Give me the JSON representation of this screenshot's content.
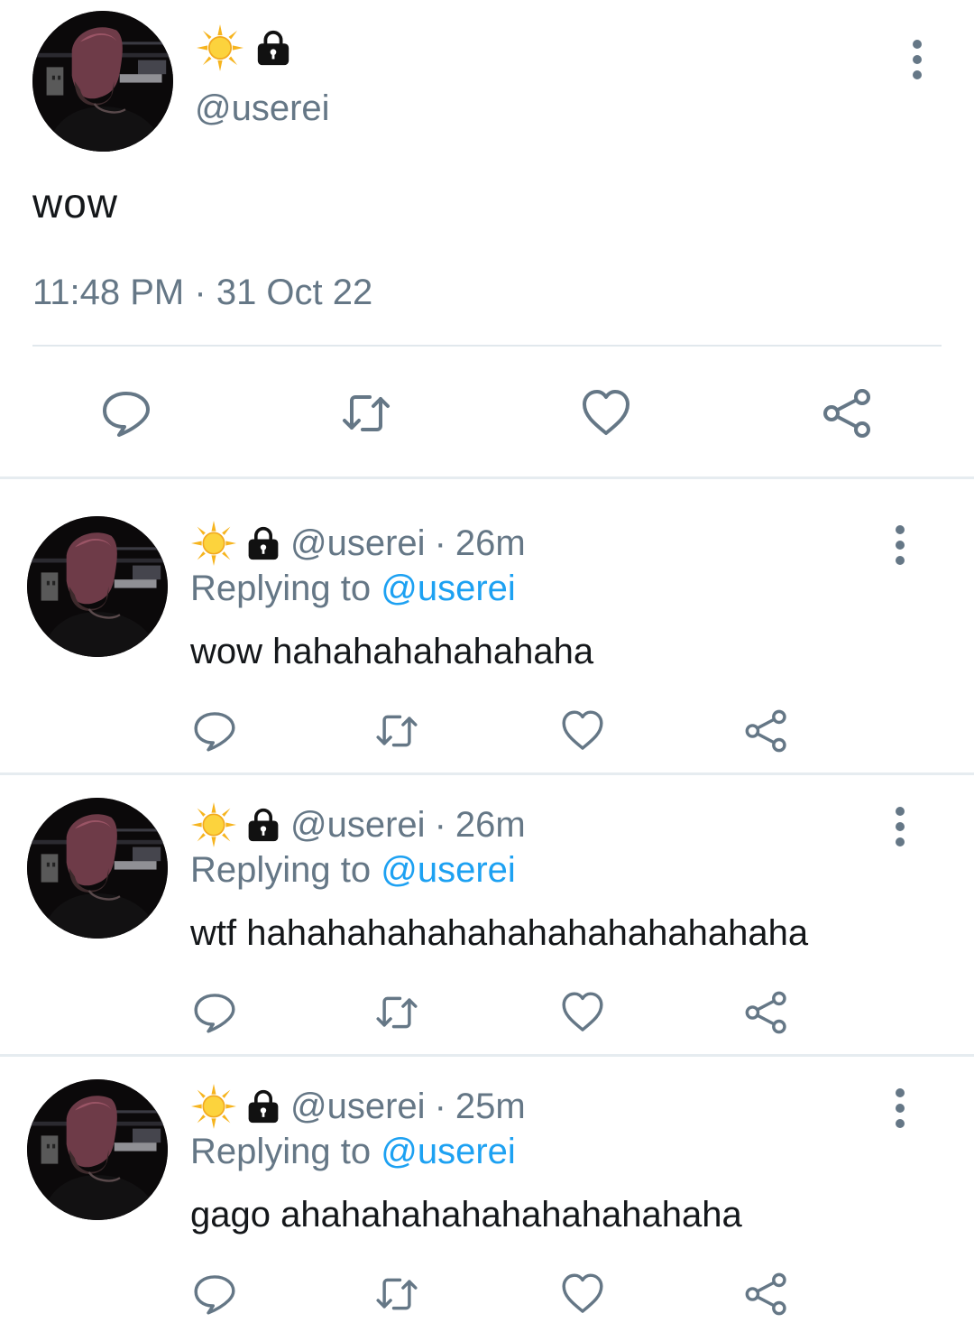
{
  "main_tweet": {
    "handle": "@userei",
    "text": "wow",
    "time": "11:48 PM",
    "separator": "·",
    "date": "31 Oct 22"
  },
  "replies": [
    {
      "handle": "@userei",
      "separator": "·",
      "age": "26m",
      "replying_label": "Replying to",
      "replying_mention": "@userei",
      "text": "wow hahahahahahahaha"
    },
    {
      "handle": "@userei",
      "separator": "·",
      "age": "26m",
      "replying_label": "Replying to",
      "replying_mention": "@userei",
      "text": "wtf hahahahahahahahahahahahahaha"
    },
    {
      "handle": "@userei",
      "separator": "·",
      "age": "25m",
      "replying_label": "Replying to",
      "replying_mention": "@userei",
      "text": "gago ahahahahahahahahahahaha"
    }
  ],
  "icons": {
    "name_emoji": "sun-icon",
    "protected": "lock-icon",
    "reply": "reply-bubble-icon",
    "retweet": "retweet-icon",
    "like": "heart-icon",
    "share": "share-icon",
    "more": "more-vertical-icon"
  },
  "colors": {
    "text": "#14171a",
    "secondary": "#657786",
    "link": "#1da1f2",
    "divider": "#e1e8ed",
    "sun": "#f6b41e"
  }
}
